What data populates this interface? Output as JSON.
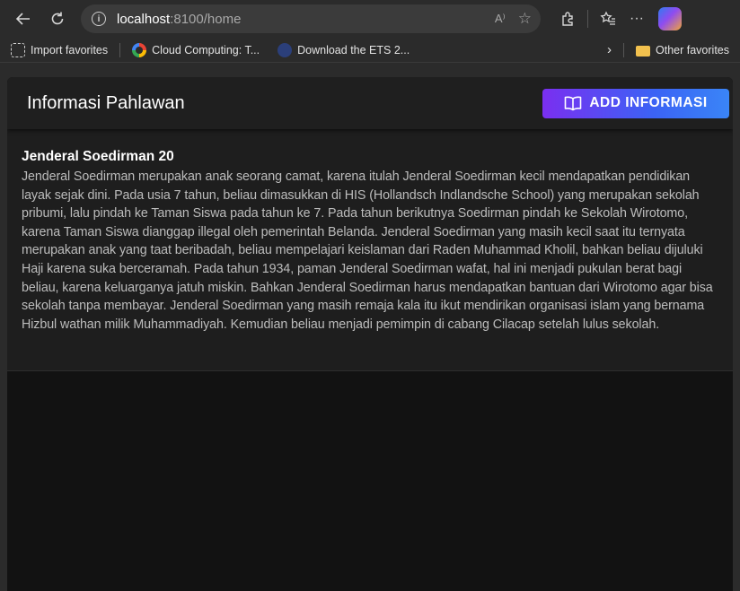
{
  "browser": {
    "url_host": "localhost",
    "url_path": ":8100/home",
    "bookmarks": [
      {
        "label": "Import favorites",
        "icon": "import-icon"
      },
      {
        "label": "Cloud Computing: T...",
        "icon": "google-icon"
      },
      {
        "label": "Download the ETS 2...",
        "icon": "ets-icon"
      }
    ],
    "other_favorites": "Other favorites"
  },
  "header": {
    "title": "Informasi Pahlawan",
    "add_button_label": "ADD INFORMASI"
  },
  "items": [
    {
      "title": "Jenderal Soedirman 20",
      "description": "Jenderal Soedirman merupakan anak seorang camat, karena itulah Jenderal Soedirman kecil mendapatkan pendidikan layak sejak dini. Pada usia 7 tahun, beliau dimasukkan di HIS (Hollandsch Indlandsche School) yang merupakan sekolah pribumi, lalu pindah ke Taman Siswa pada tahun ke 7. Pada tahun berikutnya Soedirman pindah ke Sekolah Wirotomo, karena Taman Siswa dianggap illegal oleh pemerintah Belanda. Jenderal Soedirman yang masih kecil saat itu ternyata merupakan anak yang taat beribadah, beliau mempelajari keislaman dari Raden Muhammad Kholil, bahkan beliau dijuluki Haji karena suka berceramah. Pada tahun 1934, paman Jenderal Soedirman wafat, hal ini menjadi pukulan berat bagi beliau, karena keluarganya jatuh miskin. Bahkan Jenderal Soedirman harus mendapatkan bantuan dari Wirotomo agar bisa sekolah tanpa membayar. Jenderal Soedirman yang masih remaja kala itu ikut mendirikan organisasi islam yang bernama Hizbul wathan milik Muhammadiyah. Kemudian beliau menjadi pemimpin di cabang Cilacap setelah lulus sekolah."
    }
  ],
  "colors": {
    "button_gradient_start": "#7a2ff0",
    "button_gradient_end": "#3a85f7",
    "header_bg": "#1f1f1f",
    "content_bg": "#121212"
  }
}
